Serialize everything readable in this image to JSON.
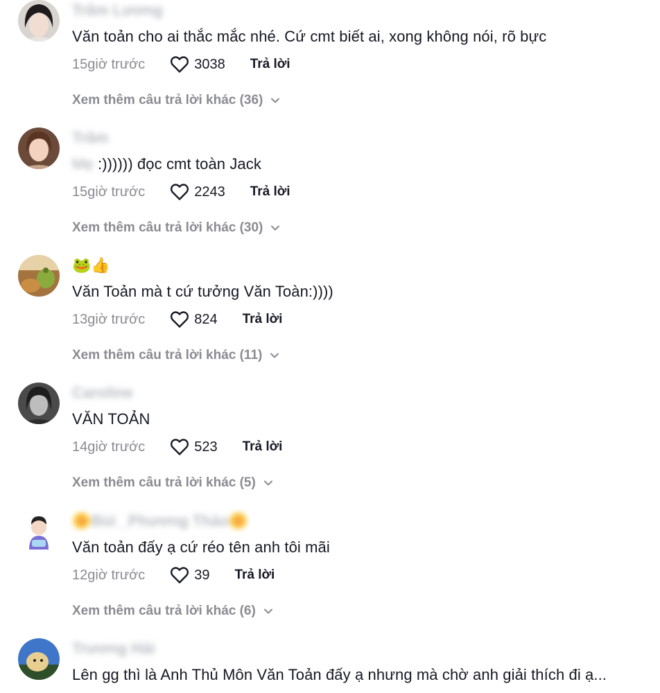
{
  "comments": [
    {
      "username": "Trâm Lương",
      "text": "Văn toản cho ai thắc mắc nhé. Cứ cmt biết ai, xong không nói, rõ bực",
      "time": "15giờ trước",
      "likes": "3038",
      "reply_label": "Trả lời",
      "more_replies": "Xem thêm câu trả lời khác (36)"
    },
    {
      "username": "Trâm",
      "text_prefix": "Mẹ",
      "text": " :)))))) đọc cmt toàn Jack",
      "time": "15giờ trước",
      "likes": "2243",
      "reply_label": "Trả lời",
      "more_replies": "Xem thêm câu trả lời khác (30)"
    },
    {
      "username": "🐸👍",
      "text": "Văn Toản mà t cứ tưởng Văn Toàn:))))",
      "time": "13giờ trước",
      "likes": "824",
      "reply_label": "Trả lời",
      "more_replies": "Xem thêm câu trả lời khác (11)"
    },
    {
      "username": "Caroline",
      "text": "VĂN TOẢN",
      "time": "14giờ trước",
      "likes": "523",
      "reply_label": "Trả lời",
      "more_replies": "Xem thêm câu trả lời khác (5)"
    },
    {
      "username": "🌼Bùi _Phương Thảo🌼",
      "text": "Văn toản đấy ạ cứ réo tên anh tôi mãi",
      "time": "12giờ trước",
      "likes": "39",
      "reply_label": "Trả lời",
      "more_replies": "Xem thêm câu trả lời khác (6)"
    },
    {
      "username": "Trương Hải",
      "text": "Lên gg thì là Anh Thủ Môn Văn Toản đấy ạ nhưng mà chờ anh giải thích đi ạ..."
    }
  ],
  "icons": {
    "like": "heart-outline-icon",
    "expand": "chevron-down-icon"
  },
  "colors": {
    "primary_text": "#161823",
    "secondary_text": "#8a8b91",
    "background": "#ffffff"
  }
}
